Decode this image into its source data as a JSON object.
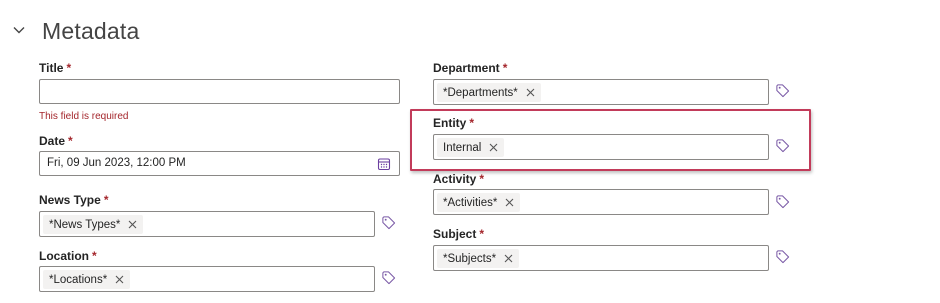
{
  "section": {
    "title": "Metadata",
    "chevron_icon": "chevron-down-icon"
  },
  "required_marker": "*",
  "colors": {
    "required": "#a4262c",
    "highlight": "#c23b5a",
    "border": "#8a8886",
    "pill": "#f3f2f1"
  },
  "left_fields": {
    "title": {
      "label": "Title",
      "value": "",
      "error": "This field is required"
    },
    "date": {
      "label": "Date",
      "value": "Fri, 09 Jun 2023, 12:00 PM",
      "icon": "calendar-icon"
    },
    "news_type": {
      "label": "News Type",
      "pill": "*News Types*",
      "icon": "tag-icon"
    },
    "location": {
      "label": "Location",
      "pill": "*Locations*",
      "icon": "tag-icon"
    }
  },
  "right_fields": {
    "department": {
      "label": "Department",
      "pill": "*Departments*",
      "icon": "tag-icon"
    },
    "entity": {
      "label": "Entity",
      "pill": "Internal",
      "icon": "tag-icon"
    },
    "activity": {
      "label": "Activity",
      "pill": "*Activities*",
      "icon": "tag-icon"
    },
    "subject": {
      "label": "Subject",
      "pill": "*Subjects*",
      "icon": "tag-icon"
    }
  }
}
